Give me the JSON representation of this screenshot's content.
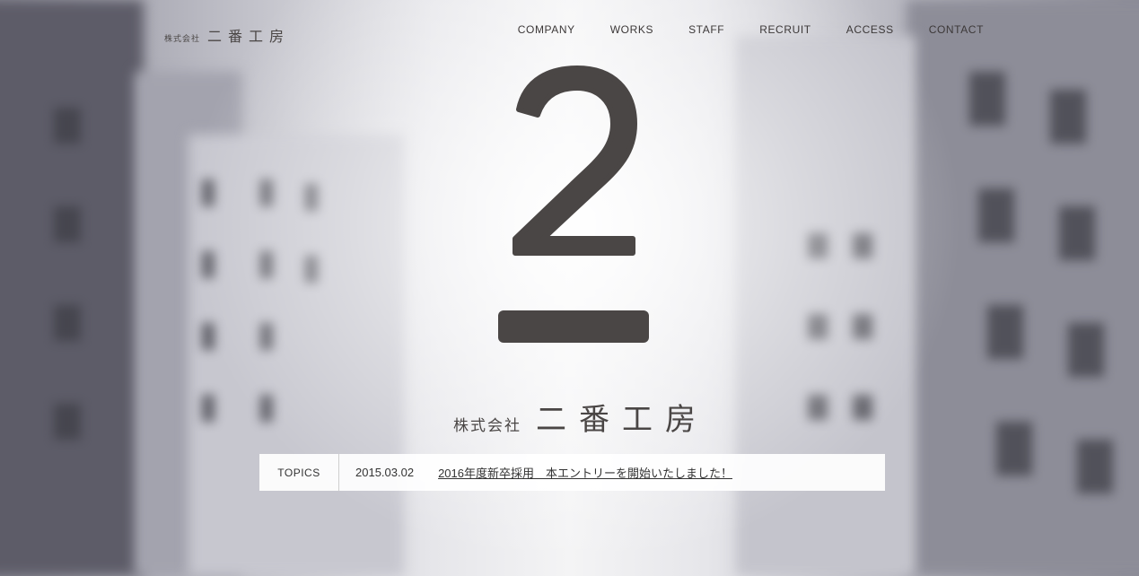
{
  "header": {
    "logo_company": "株式会社",
    "logo_name": "二番工房"
  },
  "nav": {
    "items": [
      "COMPANY",
      "WORKS",
      "STAFF",
      "RECRUIT",
      "ACCESS",
      "CONTACT"
    ]
  },
  "hero": {
    "mark_icon": "number-two-mark-icon",
    "logo_company": "株式会社",
    "logo_name": "二番工房"
  },
  "topics": {
    "label": "TOPICS",
    "date": "2015.03.02",
    "link_text": "2016年度新卒採用　本エントリーを開始いたしました！"
  },
  "colors": {
    "ink": "#4a4645",
    "panel": "#ffffff"
  }
}
